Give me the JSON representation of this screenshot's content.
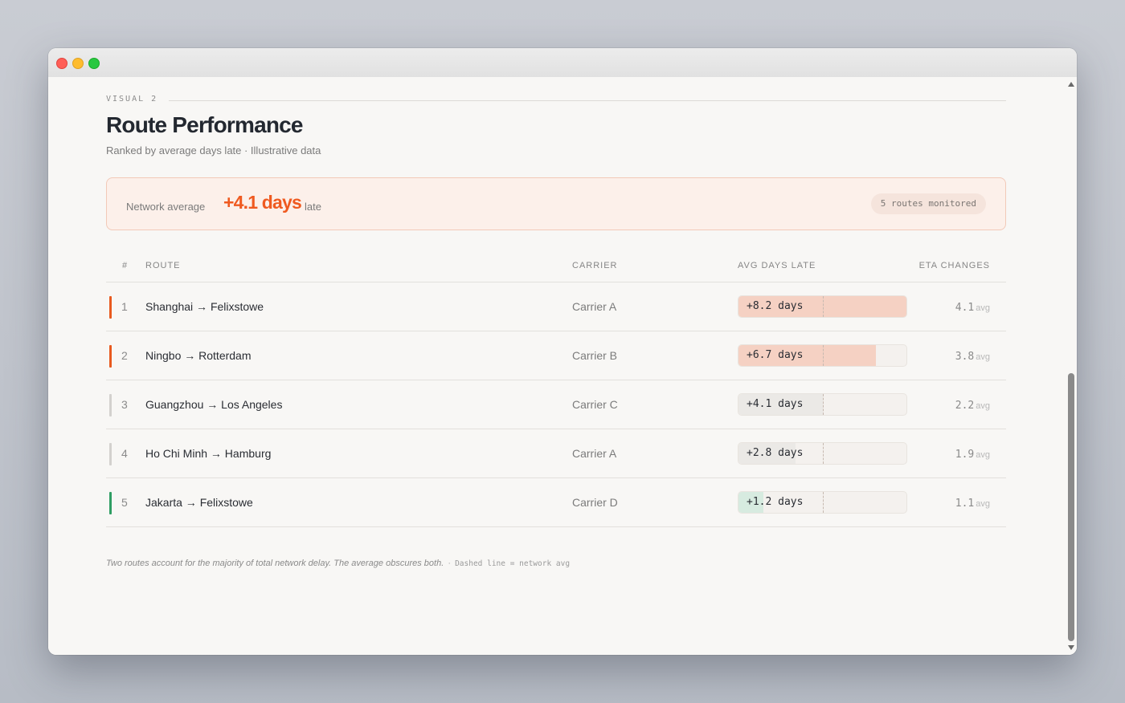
{
  "eyebrow": "VISUAL 2",
  "title": "Route Performance",
  "subtitle": "Ranked by average days late · Illustrative data",
  "summary": {
    "label": "Network average",
    "value": "+4.1 days",
    "unit": "late",
    "badge": "5 routes monitored"
  },
  "table": {
    "headers": {
      "num": "#",
      "route": "ROUTE",
      "carrier": "CARRIER",
      "delay": "AVG DAYS LATE",
      "eta": "ETA CHANGES"
    },
    "rows": [
      {
        "rank": "1",
        "route": "Shanghai → Felixstowe",
        "carrier": "Carrier A",
        "delay_label": "+8.2 days",
        "delay_value": 8.2,
        "eta": "4.1",
        "eta_unit": "avg",
        "accent": "#e85a1f",
        "fill": "#f5d1c3"
      },
      {
        "rank": "2",
        "route": "Ningbo → Rotterdam",
        "carrier": "Carrier B",
        "delay_label": "+6.7 days",
        "delay_value": 6.7,
        "eta": "3.8",
        "eta_unit": "avg",
        "accent": "#e85a1f",
        "fill": "#f5d1c3"
      },
      {
        "rank": "3",
        "route": "Guangzhou → Los Angeles",
        "carrier": "Carrier C",
        "delay_label": "+4.1 days",
        "delay_value": 4.1,
        "eta": "2.2",
        "eta_unit": "avg",
        "accent": "#d3d1ce",
        "fill": "#ebe9e6"
      },
      {
        "rank": "4",
        "route": "Ho Chi Minh → Hamburg",
        "carrier": "Carrier A",
        "delay_label": "+2.8 days",
        "delay_value": 2.8,
        "eta": "1.9",
        "eta_unit": "avg",
        "accent": "#d3d1ce",
        "fill": "#ebe9e6"
      },
      {
        "rank": "5",
        "route": "Jakarta → Felixstowe",
        "carrier": "Carrier D",
        "delay_label": "+1.2 days",
        "delay_value": 1.2,
        "eta": "1.1",
        "eta_unit": "avg",
        "accent": "#2f9e63",
        "fill": "#d7ebe0"
      }
    ],
    "scale_max": 8.2,
    "network_avg": 4.1
  },
  "footnote": {
    "main": "Two routes account for the majority of total network delay. The average obscures both.",
    "sep": "·",
    "legend": "Dashed line = network avg"
  }
}
